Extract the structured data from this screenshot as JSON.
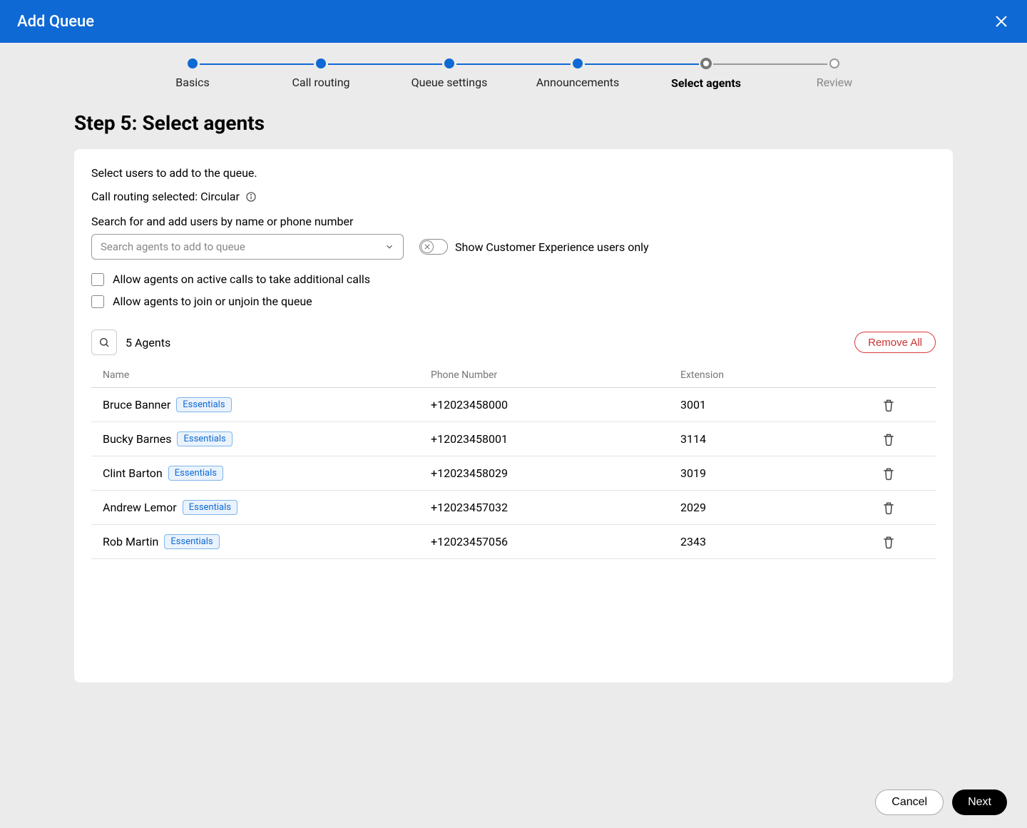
{
  "header": {
    "title": "Add Queue"
  },
  "stepper": {
    "steps": [
      {
        "label": "Basics",
        "state": "done"
      },
      {
        "label": "Call routing",
        "state": "done"
      },
      {
        "label": "Queue settings",
        "state": "done"
      },
      {
        "label": "Announcements",
        "state": "done"
      },
      {
        "label": "Select agents",
        "state": "current"
      },
      {
        "label": "Review",
        "state": "upcoming"
      }
    ]
  },
  "page": {
    "title": "Step 5: Select agents",
    "description": "Select users to add to the queue.",
    "routing_prefix": "Call routing selected: ",
    "routing_value": "Circular"
  },
  "search": {
    "label": "Search for and add users by name or phone number",
    "placeholder": "Search agents to add to queue"
  },
  "toggle": {
    "label": "Show Customer Experience users only",
    "on": false
  },
  "checks": {
    "additional_calls_label": "Allow agents on active calls to take additional calls",
    "additional_calls_checked": false,
    "join_unjoin_label": "Allow agents to join or unjoin the queue",
    "join_unjoin_checked": false
  },
  "table": {
    "count_label": "5 Agents",
    "remove_all_label": "Remove All",
    "columns": {
      "name": "Name",
      "phone": "Phone Number",
      "ext": "Extension"
    },
    "badge_label": "Essentials",
    "rows": [
      {
        "name": "Bruce Banner",
        "phone": "+12023458000",
        "ext": "3001"
      },
      {
        "name": "Bucky Barnes",
        "phone": "+12023458001",
        "ext": "3114"
      },
      {
        "name": "Clint Barton",
        "phone": "+12023458029",
        "ext": "3019"
      },
      {
        "name": "Andrew Lemor",
        "phone": "+12023457032",
        "ext": "2029"
      },
      {
        "name": "Rob Martin",
        "phone": "+12023457056",
        "ext": "2343"
      }
    ]
  },
  "footer": {
    "cancel": "Cancel",
    "next": "Next"
  }
}
